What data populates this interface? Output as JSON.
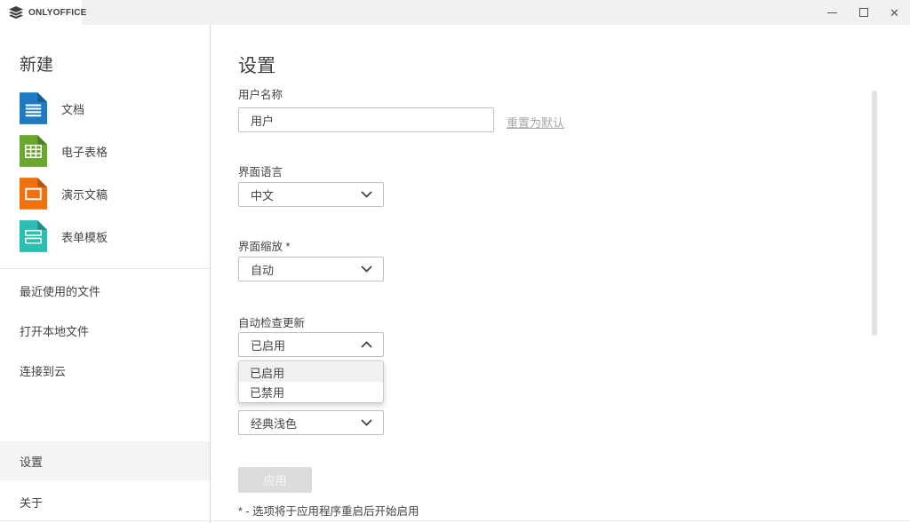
{
  "window": {
    "tab": {
      "label": "ONLYOFFICE"
    },
    "icons": {
      "close": "✕"
    }
  },
  "sidebar": {
    "new_section": {
      "title": "新建",
      "items": [
        {
          "label": "文档",
          "icon": "document-icon",
          "color": "#1e7bc1"
        },
        {
          "label": "电子表格",
          "icon": "spreadsheet-icon",
          "color": "#69a82c"
        },
        {
          "label": "演示文稿",
          "icon": "presentation-icon",
          "color": "#ee7212"
        },
        {
          "label": "表单模板",
          "icon": "form-template-icon",
          "color": "#2dbdb1"
        }
      ]
    },
    "menu_items": [
      {
        "label": "最近使用的文件"
      },
      {
        "label": "打开本地文件"
      },
      {
        "label": "连接到云"
      }
    ],
    "bottom_items": [
      {
        "label": "设置",
        "selected": true
      },
      {
        "label": "关于",
        "selected": false
      }
    ]
  },
  "settings": {
    "title": "设置",
    "username": {
      "label": "用户名称",
      "value": "用户",
      "reset_link": "重置为默认"
    },
    "language": {
      "label": "界面语言",
      "value": "中文"
    },
    "scaling": {
      "label": "界面缩放 *",
      "value": "自动"
    },
    "updates": {
      "label": "自动检查更新",
      "value": "已启用",
      "options": [
        "已启用",
        "已禁用"
      ],
      "selected_option": "已启用",
      "open": true
    },
    "theme": {
      "value": "经典浅色"
    },
    "apply_button": "应用",
    "footnote": "* - 选项将于应用程序重启后开始启用"
  }
}
